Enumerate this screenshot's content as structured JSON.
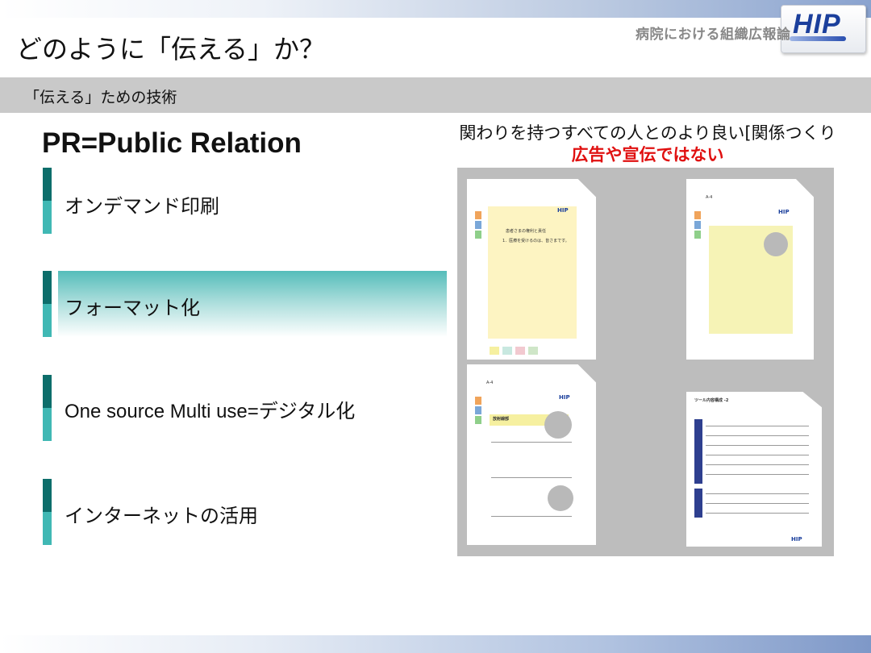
{
  "header": {
    "title": "どのように「伝える」か？",
    "subtitle": "病院における組織広報論",
    "logo_text": "HIP"
  },
  "section": {
    "label": "「伝える」ための技術"
  },
  "left": {
    "heading": "PR=Public Relation",
    "items": [
      {
        "label": "オンデマンド印刷"
      },
      {
        "label": "フォーマット化"
      },
      {
        "label": "One source Multi use=デジタル化"
      },
      {
        "label": "インターネットの活用"
      }
    ],
    "highlighted_index": 1
  },
  "right": {
    "heading": "関わりを持つすべての人とのより良い[関係つくり",
    "subheading": "広告や宣伝ではない",
    "thumbnails": [
      {
        "title": "患者さまの権利と責任",
        "body": "1．医療を受けるのは、皆さまです。",
        "logo": "HIP"
      },
      {
        "size_label": "A-4",
        "logo": "HIP"
      },
      {
        "size_label": "A-4",
        "title": "放射線部",
        "logo": "HIP"
      },
      {
        "title": "ツール内容構成 -2",
        "logo": "HIP"
      }
    ]
  },
  "colors": {
    "accent_teal_dark": "#0d6e6b",
    "accent_teal_light": "#40b8b4",
    "emphasis_red": "#e01010",
    "section_gray": "#c9c9c9",
    "logo_blue": "#1b3f9c"
  }
}
